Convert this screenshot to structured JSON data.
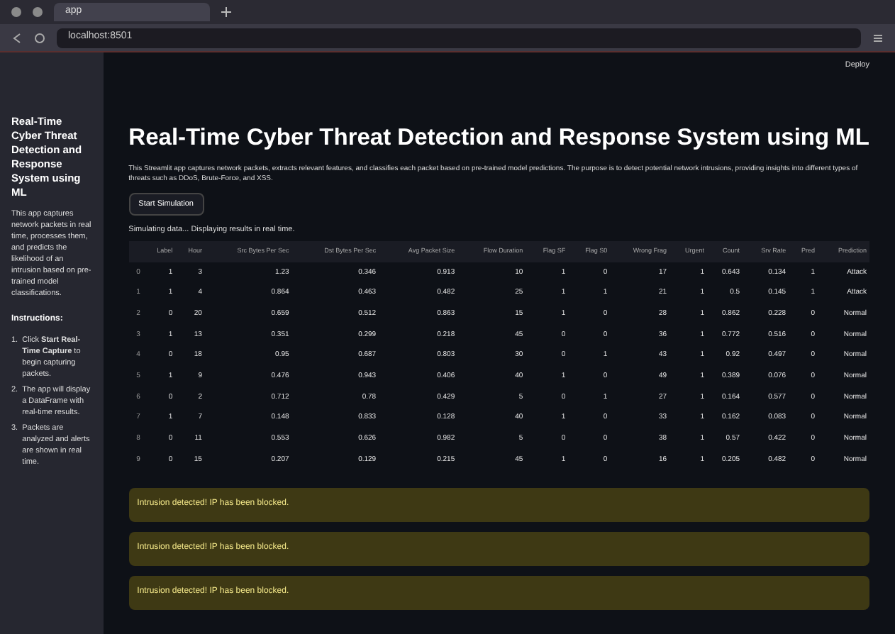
{
  "browser": {
    "tab_title": "app",
    "address": "localhost:8501"
  },
  "header": {
    "deploy": "Deploy"
  },
  "sidebar": {
    "title": "Real-Time Cyber Threat Detection and Response System using ML",
    "description": "This app captures network packets in real time, processes them, and predicts the likelihood of an intrusion based on pre-trained model classifications.",
    "instructions_heading": "Instructions:",
    "instructions": [
      {
        "number": "1.",
        "text": "Click **Start Real-Time Capture** to begin capturing packets."
      },
      {
        "number": "2.",
        "text": "The app will display a DataFrame with real-time results."
      },
      {
        "number": "3.",
        "text": "Packets are analyzed and alerts are shown in real time."
      }
    ]
  },
  "main": {
    "title": "Real-Time Cyber Threat Detection and Response System using ML",
    "description": "This Streamlit app captures network packets, extracts relevant features, and classifies each packet based on pre-trained model predictions. The purpose is to detect potential network intrusions, providing insights into different types of threats such as DDoS, Brute-Force, and XSS.",
    "button": "Start Simulation",
    "status": "Simulating data... Displaying results in real time.",
    "table": {
      "columns": [
        "",
        "Label",
        "Hour",
        "Src Bytes Per Sec",
        "Dst Bytes Per Sec",
        "Avg Packet Size",
        "Flow Duration",
        "Flag SF",
        "Flag S0",
        "Wrong Frag",
        "Urgent",
        "Count",
        "Srv Rate",
        "Pred",
        "Prediction"
      ],
      "rows": [
        [
          "0",
          "1",
          "3",
          "1.23",
          "0.346",
          "0.913",
          "10",
          "1",
          "0",
          "17",
          "1",
          "0.643",
          "0.134",
          "1",
          "Attack"
        ],
        [
          "1",
          "1",
          "4",
          "0.864",
          "0.463",
          "0.482",
          "25",
          "1",
          "1",
          "21",
          "1",
          "0.5",
          "0.145",
          "1",
          "Attack"
        ],
        [
          "2",
          "0",
          "20",
          "0.659",
          "0.512",
          "0.863",
          "15",
          "1",
          "0",
          "28",
          "1",
          "0.862",
          "0.228",
          "0",
          "Normal"
        ],
        [
          "3",
          "1",
          "13",
          "0.351",
          "0.299",
          "0.218",
          "45",
          "0",
          "0",
          "36",
          "1",
          "0.772",
          "0.516",
          "0",
          "Normal"
        ],
        [
          "4",
          "0",
          "18",
          "0.95",
          "0.687",
          "0.803",
          "30",
          "0",
          "1",
          "43",
          "1",
          "0.92",
          "0.497",
          "0",
          "Normal"
        ],
        [
          "5",
          "1",
          "9",
          "0.476",
          "0.943",
          "0.406",
          "40",
          "1",
          "0",
          "49",
          "1",
          "0.389",
          "0.076",
          "0",
          "Normal"
        ],
        [
          "6",
          "0",
          "2",
          "0.712",
          "0.78",
          "0.429",
          "5",
          "0",
          "1",
          "27",
          "1",
          "0.164",
          "0.577",
          "0",
          "Normal"
        ],
        [
          "7",
          "1",
          "7",
          "0.148",
          "0.833",
          "0.128",
          "40",
          "1",
          "0",
          "33",
          "1",
          "0.162",
          "0.083",
          "0",
          "Normal"
        ],
        [
          "8",
          "0",
          "11",
          "0.553",
          "0.626",
          "0.982",
          "5",
          "0",
          "0",
          "38",
          "1",
          "0.57",
          "0.422",
          "0",
          "Normal"
        ],
        [
          "9",
          "0",
          "15",
          "0.207",
          "0.129",
          "0.215",
          "45",
          "1",
          "0",
          "16",
          "1",
          "0.205",
          "0.482",
          "0",
          "Normal"
        ]
      ]
    },
    "alerts": [
      {
        "text": "Intrusion detected! IP has been blocked."
      },
      {
        "text": "Intrusion detected! IP has been blocked."
      },
      {
        "text": "Intrusion detected! IP has been blocked."
      }
    ]
  }
}
